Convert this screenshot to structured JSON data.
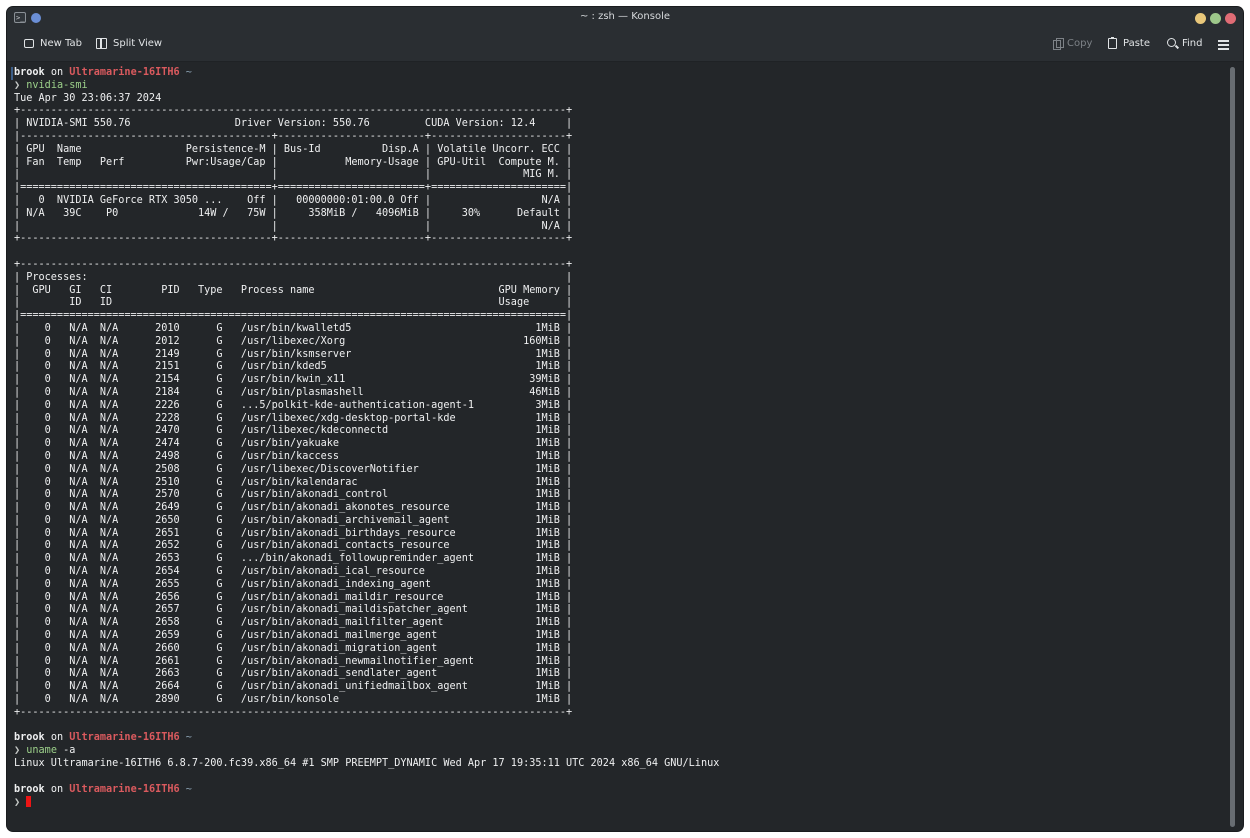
{
  "window": {
    "title": "~ : zsh — Konsole",
    "colors": {
      "minimize": "#e8c77a",
      "maximize": "#9dc78a",
      "close": "#e06c75"
    }
  },
  "toolbar": {
    "new_tab": "New Tab",
    "split_view": "Split View",
    "copy": "Copy",
    "paste": "Paste",
    "find": "Find"
  },
  "icons": {
    "app": "terminal-icon",
    "new_tab": "new-tab-icon",
    "split_view": "split-view-icon",
    "copy": "copy-icon",
    "paste": "paste-icon",
    "find": "search-icon",
    "menu": "hamburger-menu-icon"
  },
  "prompt": {
    "user": "brook",
    "on": "on",
    "host": "Ultramarine-16ITH6",
    "dir": "~",
    "symbol": "❯"
  },
  "commands": {
    "c1": "nvidia-smi",
    "c2": "uname",
    "c2_args": "-a"
  },
  "nvsmi": {
    "date": "Tue Apr 30 23:06:37 2024",
    "border": "+-----------------------------------------------------------------------------------------+",
    "header": "| NVIDIA-SMI 550.76                 Driver Version: 550.76         CUDA Version: 12.4     |",
    "sep1": "|-----------------------------------------+------------------------+----------------------+",
    "colhdr1": "| GPU  Name                 Persistence-M | Bus-Id          Disp.A | Volatile Uncorr. ECC |",
    "colhdr2": "| Fan  Temp   Perf          Pwr:Usage/Cap |           Memory-Usage | GPU-Util  Compute M. |",
    "colhdr3": "|                                         |                        |               MIG M. |",
    "sep2": "|=========================================+========================+======================|",
    "gpu1": "|   0  NVIDIA GeForce RTX 3050 ...    Off |   00000000:01:00.0 Off |                  N/A |",
    "gpu2": "| N/A   39C    P0             14W /   75W |     358MiB /   4096MiB |     30%      Default |",
    "gpu3": "|                                         |                        |                  N/A |",
    "sep3": "+-----------------------------------------+------------------------+----------------------+",
    "proc_title": "| Processes:                                                                              |",
    "proc_hdr1": "|  GPU   GI   CI        PID   Type   Process name                              GPU Memory |",
    "proc_hdr2": "|        ID   ID                                                               Usage      |",
    "proc_sep": "|=========================================================================================|",
    "processes": [
      "|    0   N/A  N/A      2010      G   /usr/bin/kwalletd5                              1MiB |",
      "|    0   N/A  N/A      2012      G   /usr/libexec/Xorg                             160MiB |",
      "|    0   N/A  N/A      2149      G   /usr/bin/ksmserver                              1MiB |",
      "|    0   N/A  N/A      2151      G   /usr/bin/kded5                                  1MiB |",
      "|    0   N/A  N/A      2154      G   /usr/bin/kwin_x11                              39MiB |",
      "|    0   N/A  N/A      2184      G   /usr/bin/plasmashell                           46MiB |",
      "|    0   N/A  N/A      2226      G   ...5/polkit-kde-authentication-agent-1          3MiB |",
      "|    0   N/A  N/A      2228      G   /usr/libexec/xdg-desktop-portal-kde             1MiB |",
      "|    0   N/A  N/A      2470      G   /usr/libexec/kdeconnectd                        1MiB |",
      "|    0   N/A  N/A      2474      G   /usr/bin/yakuake                                1MiB |",
      "|    0   N/A  N/A      2498      G   /usr/bin/kaccess                                1MiB |",
      "|    0   N/A  N/A      2508      G   /usr/libexec/DiscoverNotifier                   1MiB |",
      "|    0   N/A  N/A      2510      G   /usr/bin/kalendarac                             1MiB |",
      "|    0   N/A  N/A      2570      G   /usr/bin/akonadi_control                        1MiB |",
      "|    0   N/A  N/A      2649      G   /usr/bin/akonadi_akonotes_resource              1MiB |",
      "|    0   N/A  N/A      2650      G   /usr/bin/akonadi_archivemail_agent              1MiB |",
      "|    0   N/A  N/A      2651      G   /usr/bin/akonadi_birthdays_resource             1MiB |",
      "|    0   N/A  N/A      2652      G   /usr/bin/akonadi_contacts_resource              1MiB |",
      "|    0   N/A  N/A      2653      G   .../bin/akonadi_followupreminder_agent          1MiB |",
      "|    0   N/A  N/A      2654      G   /usr/bin/akonadi_ical_resource                  1MiB |",
      "|    0   N/A  N/A      2655      G   /usr/bin/akonadi_indexing_agent                 1MiB |",
      "|    0   N/A  N/A      2656      G   /usr/bin/akonadi_maildir_resource               1MiB |",
      "|    0   N/A  N/A      2657      G   /usr/bin/akonadi_maildispatcher_agent           1MiB |",
      "|    0   N/A  N/A      2658      G   /usr/bin/akonadi_mailfilter_agent               1MiB |",
      "|    0   N/A  N/A      2659      G   /usr/bin/akonadi_mailmerge_agent                1MiB |",
      "|    0   N/A  N/A      2660      G   /usr/bin/akonadi_migration_agent                1MiB |",
      "|    0   N/A  N/A      2661      G   /usr/bin/akonadi_newmailnotifier_agent          1MiB |",
      "|    0   N/A  N/A      2663      G   /usr/bin/akonadi_sendlater_agent                1MiB |",
      "|    0   N/A  N/A      2664      G   /usr/bin/akonadi_unifiedmailbox_agent           1MiB |",
      "|    0   N/A  N/A      2890      G   /usr/bin/konsole                                1MiB |"
    ]
  },
  "uname_output": "Linux Ultramarine-16ITH6 6.8.7-200.fc39.x86_64 #1 SMP PREEMPT_DYNAMIC Wed Apr 17 19:35:11 UTC 2024 x86_64 GNU/Linux"
}
